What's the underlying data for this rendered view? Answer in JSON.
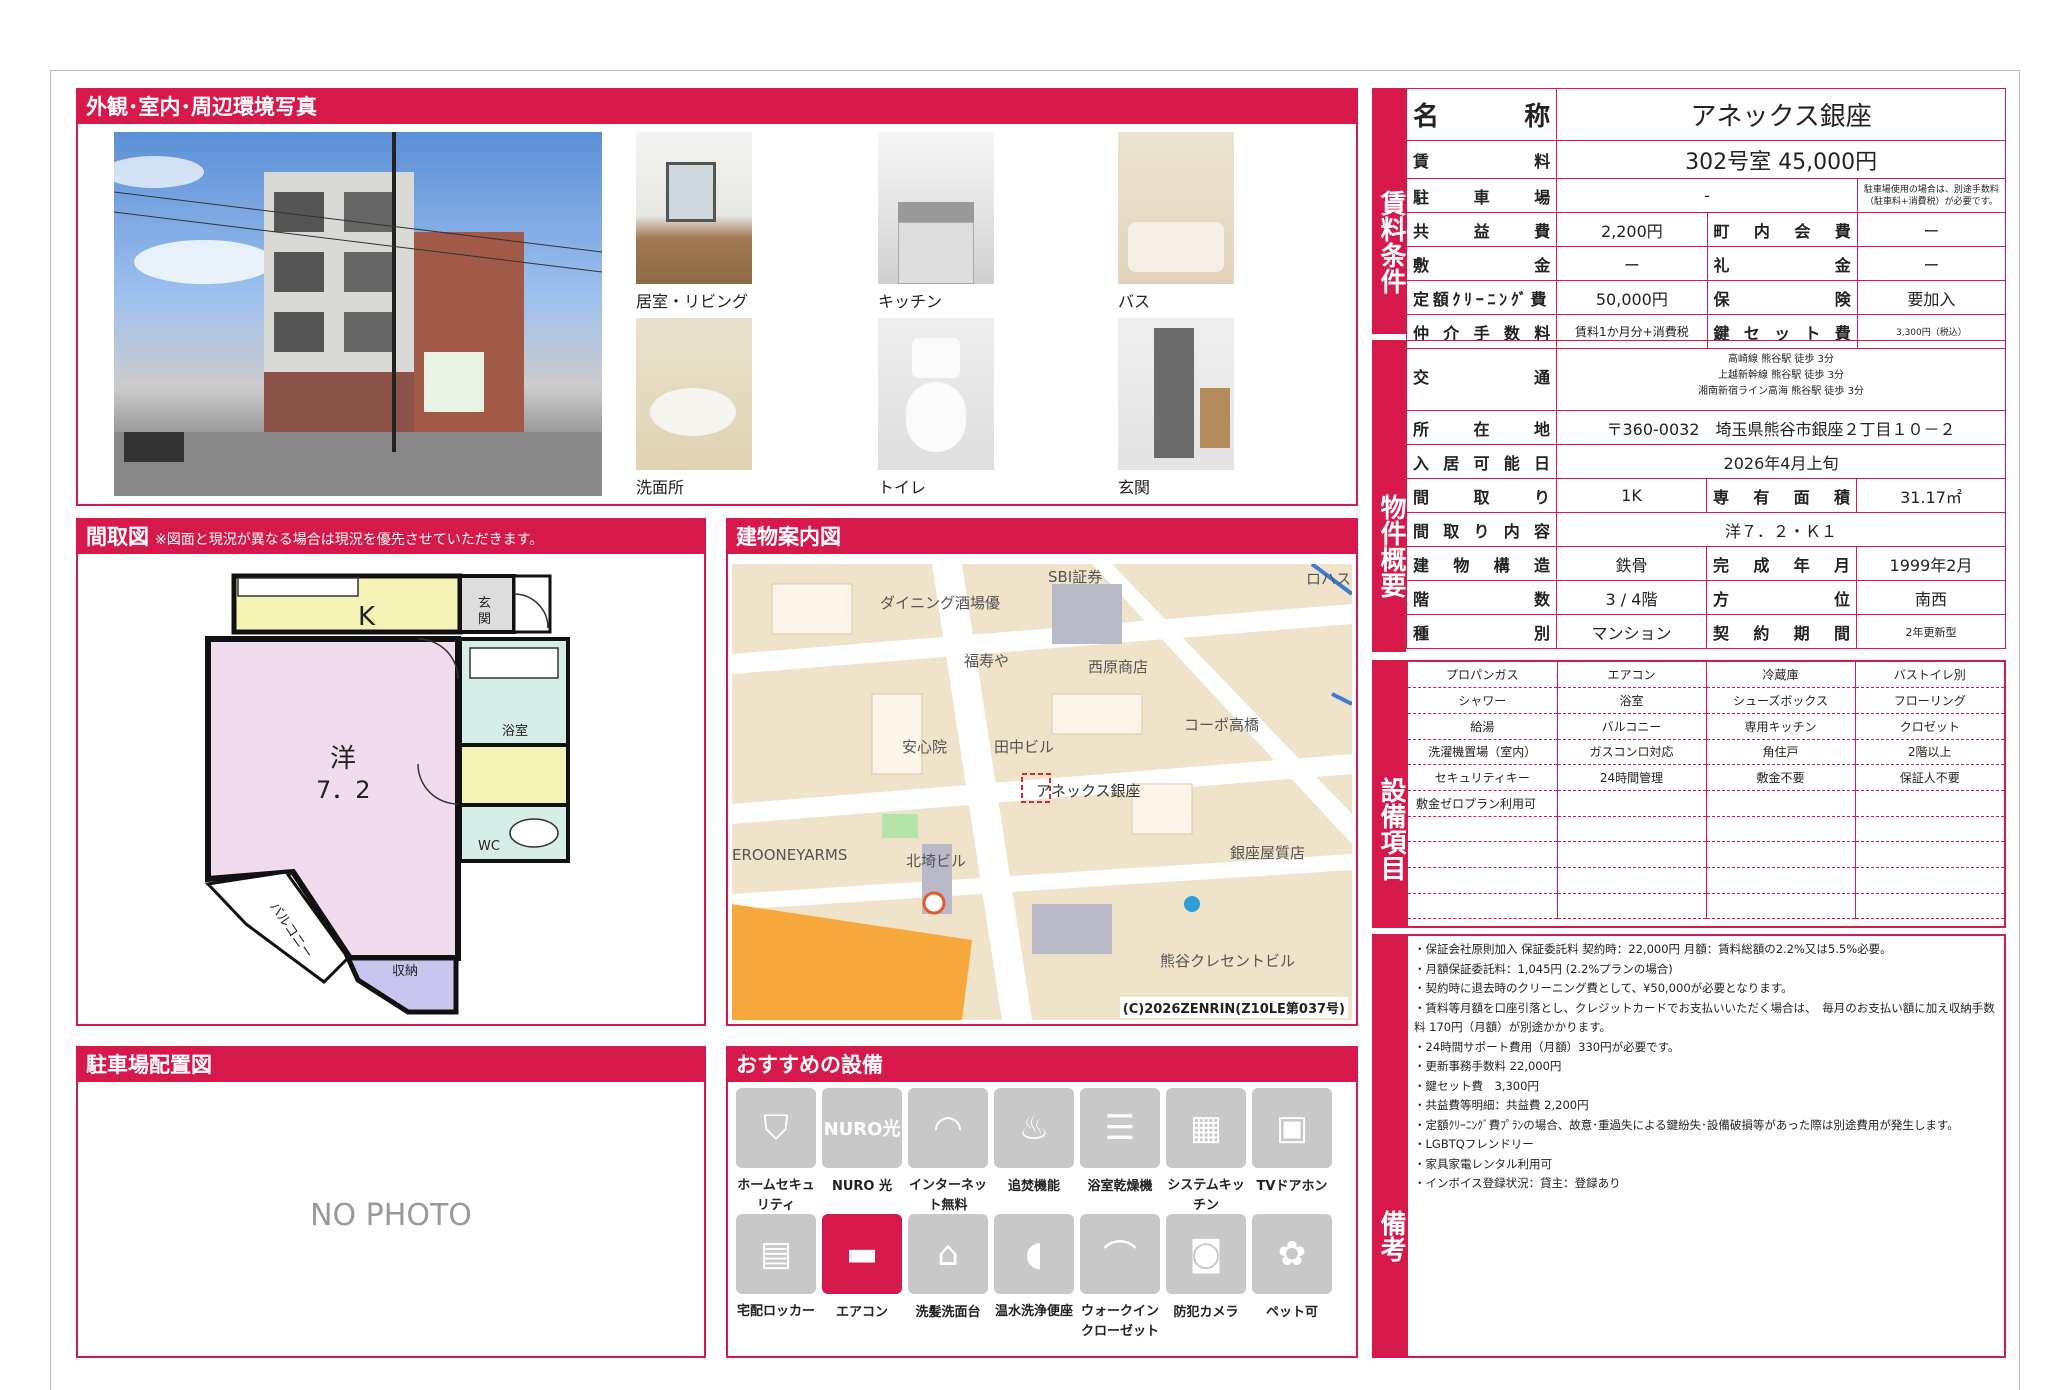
{
  "photos_panel": {
    "title": "外観･室内･周辺環境写真",
    "captions": [
      "居室・リビング",
      "キッチン",
      "バス",
      "洗面所",
      "トイレ",
      "玄関"
    ]
  },
  "floorplan_panel": {
    "title": "間取図",
    "note": "※図面と現況が異なる場合は現況を優先させていただきます。",
    "labels": {
      "kitchen": "K",
      "entrance": "玄関",
      "room": "洋",
      "room_size": "7．2",
      "bath": "浴室",
      "wc": "WC",
      "balcony": "バルコニー",
      "storage": "収納"
    }
  },
  "map_panel": {
    "title": "建物案内図",
    "labels": [
      "SBI証券",
      "ダイニング酒場優",
      "福寿や",
      "西原商店",
      "コーポ高橋",
      "安心院",
      "田中ビル",
      "アネックス銀座",
      "EROONEYARMS",
      "北埼ビル",
      "銀座屋質店",
      "熊谷クレセントビル",
      "ロハス"
    ],
    "copyright": "(C)2026ZENRIN(Z10LE第037号)"
  },
  "parking_panel": {
    "title": "駐車場配置図",
    "no_photo": "NO PHOTO"
  },
  "amenities_panel": {
    "title": "おすすめの設備",
    "items": [
      {
        "label": "ホームセキュリティ",
        "icon": "shield-icon",
        "on": false
      },
      {
        "label": "NURO 光",
        "icon": "nuro-icon",
        "on": false
      },
      {
        "label": "インターネット無料",
        "icon": "wifi-icon",
        "on": false
      },
      {
        "label": "追焚機能",
        "icon": "bathtub-icon",
        "on": false
      },
      {
        "label": "浴室乾燥機",
        "icon": "bath-dryer-icon",
        "on": false
      },
      {
        "label": "システムキッチン",
        "icon": "kitchen-icon",
        "on": false
      },
      {
        "label": "TVドアホン",
        "icon": "intercom-icon",
        "on": false
      },
      {
        "label": "宅配ロッカー",
        "icon": "locker-icon",
        "on": false
      },
      {
        "label": "エアコン",
        "icon": "aircon-icon",
        "on": true
      },
      {
        "label": "洗髪洗面台",
        "icon": "washbasin-icon",
        "on": false
      },
      {
        "label": "温水洗浄便座",
        "icon": "toilet-icon",
        "on": false
      },
      {
        "label": "ウォークインクローゼット",
        "icon": "closet-icon",
        "on": false
      },
      {
        "label": "防犯カメラ",
        "icon": "camera-icon",
        "on": false
      },
      {
        "label": "ペット可",
        "icon": "paw-icon",
        "on": false
      }
    ]
  },
  "rent_conditions": {
    "side_label": "賃料条件",
    "name_label": "名称",
    "name": "アネックス銀座",
    "rent_label": "賃料",
    "rent": "302号室 45,000円",
    "parking_label": "駐車場",
    "parking": "-",
    "parking_note": "駐車場使用の場合は、別途手数料（駐車料+消費税）が必要です。",
    "common_fee_label": "共益費",
    "common_fee": "2,200円",
    "town_fee_label": "町内会費",
    "town_fee": "ー",
    "deposit_label": "敷金",
    "deposit": "ー",
    "key_money_label": "礼金",
    "key_money": "ー",
    "cleaning_label": "定額ｸﾘｰﾆﾝｸﾞ費",
    "cleaning": "50,000円",
    "insurance_label": "保険",
    "insurance": "要加入",
    "brokerage_label": "仲介手数料",
    "brokerage": "賃料1か月分+消費税",
    "key_exchange_label": "鍵セット費",
    "key_exchange": "3,300円（税込）"
  },
  "property_overview": {
    "side_label": "物件概要",
    "transport_label": "交通",
    "transport": [
      "高崎線 熊谷駅 徒歩 3分",
      "上越新幹線 熊谷駅 徒歩 3分",
      "湘南新宿ライン高海 熊谷駅 徒歩 3分"
    ],
    "address_label": "所在地",
    "address": "〒360-0032　埼玉県熊谷市銀座２丁目１０－２",
    "move_in_label": "入居可能日",
    "move_in": "2026年4月上旬",
    "layout_label": "間取り",
    "layout": "1K",
    "area_label": "専有面積",
    "area": "31.17㎡",
    "layout_detail_label": "間取り内容",
    "layout_detail": "洋７．２・Ｋ１",
    "structure_label": "建物構造",
    "structure": "鉄骨",
    "built_label": "完成年月",
    "built": "1999年2月",
    "floors_label": "階数",
    "floors": "3 / 4階",
    "direction_label": "方位",
    "direction": "南西",
    "type_label": "種別",
    "type": "マンション",
    "contract_label": "契約期間",
    "contract": "2年更新型"
  },
  "facilities": {
    "side_label": "設備項目",
    "rows": [
      [
        "プロパンガス",
        "エアコン",
        "冷蔵庫",
        "バストイレ別"
      ],
      [
        "シャワー",
        "浴室",
        "シューズボックス",
        "フローリング"
      ],
      [
        "給湯",
        "バルコニー",
        "専用キッチン",
        "クロゼット"
      ],
      [
        "洗濯機置場（室内）",
        "ガスコンロ対応",
        "角住戸",
        "2階以上"
      ],
      [
        "セキュリティキー",
        "24時間管理",
        "敷金不要",
        "保証人不要"
      ],
      [
        "敷金ゼロプラン利用可",
        "",
        "",
        ""
      ],
      [
        "",
        "",
        "",
        ""
      ],
      [
        "",
        "",
        "",
        ""
      ],
      [
        "",
        "",
        "",
        ""
      ],
      [
        "",
        "",
        "",
        ""
      ]
    ]
  },
  "remarks": {
    "side_label": "備考",
    "lines": [
      "・保証会社原則加入 保証委託料 契約時：22,000円 月額：賃料総額の2.2%又は5.5%必要。",
      "・月額保証委託料：1,045円 (2.2%プランの場合)",
      "・契約時に退去時のクリーニング費として、¥50,000が必要となります。",
      "・賃料等月額を口座引落とし、クレジットカードでお支払いいただく場合は、　毎月のお支払い額に加え収納手数料 170円（月額）が別途かかります。",
      "・24時間サポート費用（月額）330円が必要です。",
      "・更新事務手数料 22,000円",
      "・鍵セット費　3,300円",
      "・共益費等明細：共益費 2,200円",
      "・定額ｸﾘｰﾆﾝｸﾞ費ﾌﾟﾗﾝの場合、故意･重過失による鍵紛失･設備破損等があった際は別途費用が発生します。",
      "・LGBTQフレンドリー",
      "・家具家電レンタル利用可",
      "・インボイス登録状況：貸主：登録あり"
    ]
  }
}
